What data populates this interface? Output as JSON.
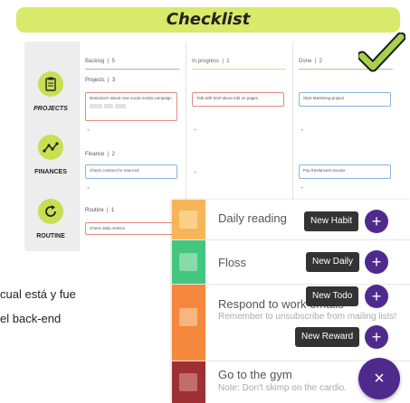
{
  "banner": {
    "title": "Checklist"
  },
  "nav": {
    "projects": "PROJECTS",
    "finances": "FINANCES",
    "routine": "ROUTINE"
  },
  "kanban": {
    "columns": [
      {
        "name": "Backlog",
        "count": "5",
        "accent": "#e3a08d"
      },
      {
        "name": "In progress",
        "count": "1",
        "accent": "#e8d783"
      },
      {
        "name": "Done",
        "count": "2",
        "accent": "#a6cf86"
      }
    ],
    "groups": {
      "projects": {
        "name": "Projects",
        "count": "3"
      },
      "finance": {
        "name": "Finance",
        "count": "2"
      },
      "routine": {
        "name": "Routine",
        "count": "1"
      }
    },
    "cards": {
      "backlog_projects": "Brainstorm about new social media campaign",
      "progress_projects": "Talk with brief about edit on pages",
      "done_projects": "Start Marketing project",
      "backlog_finance": "Check contract for new tool",
      "done_finance": "Pay freelancers invoice",
      "backlog_routine": "Check daily metrics"
    }
  },
  "background_note": {
    "line1": "cual está y fue",
    "line2": "el back-end"
  },
  "tasks": [
    {
      "title": "Daily reading",
      "note": "",
      "color": "#f7b55a",
      "check": "#fbd189"
    },
    {
      "title": "Floss",
      "note": "",
      "color": "#43c77f",
      "check": "#86dba9"
    },
    {
      "title": "Respond to work emails",
      "note": "Remember to unsubscribe from mailing lists!",
      "color": "#f5883c",
      "check": "#f8b57f"
    },
    {
      "title": "Go to the gym",
      "note": "Note: Don't skimp on the cardio.",
      "color": "#9e3034",
      "check": "#c26c6e"
    }
  ],
  "fab": {
    "new_habit": "New Habit",
    "new_daily": "New Daily",
    "new_todo": "New Todo",
    "new_reward": "New Reward",
    "plus": "+",
    "close": "×"
  },
  "colors": {
    "accent_green": "#d9e96a",
    "fab_purple": "#4f2a8d"
  }
}
